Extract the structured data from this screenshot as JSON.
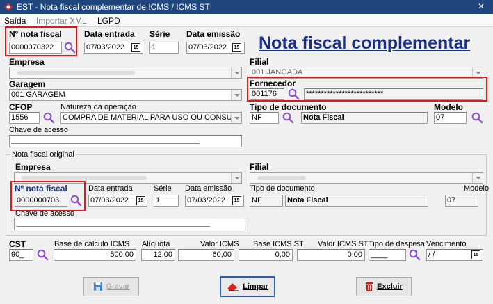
{
  "window": {
    "title": "EST - Nota fiscal complementar de ICMS / ICMS ST",
    "close": "×"
  },
  "menu": [
    "Saída",
    "Importar XML",
    "LGPD"
  ],
  "heading": "Nota fiscal complementar",
  "top": {
    "nf_label": "Nº nota fiscal",
    "nf_value": "0000070322",
    "data_entrada_label": "Data entrada",
    "data_entrada": "07/03/2022",
    "serie_label": "Série",
    "serie": "1",
    "data_emissao_label": "Data emissão",
    "data_emissao": "07/03/2022",
    "empresa_label": "Empresa",
    "filial_label": "Filial",
    "filial": "001 JANGADA",
    "garagem_label": "Garagem",
    "garagem": "001 GARAGEM",
    "fornecedor_label": "Fornecedor",
    "fornecedor_code": "001176",
    "fornecedor_name": "**************************",
    "cfop_label": "CFOP",
    "cfop": "1556",
    "natureza_label": "Natureza da operação",
    "natureza": "COMPRA DE MATERIAL PARA USO OU CONSUMO",
    "tipo_doc_label": "Tipo de documento",
    "tipo_doc_code": "NF",
    "tipo_doc_name": "Nota Fiscal",
    "modelo_label": "Modelo",
    "modelo": "07",
    "chave_label": "Chave de acesso"
  },
  "original": {
    "group_label": "Nota fiscal original",
    "empresa_label": "Empresa",
    "filial_label": "Filial",
    "nf_label": "Nº nota fiscal",
    "nf_value": "0000000703",
    "data_entrada_label": "Data entrada",
    "data_entrada": "07/03/2022",
    "serie_label": "Série",
    "serie": "1",
    "data_emissao_label": "Data emissão",
    "data_emissao": "07/03/2022",
    "tipo_doc_label": "Tipo de documento",
    "tipo_doc_code": "NF",
    "tipo_doc_name": "Nota Fiscal",
    "modelo_label": "Modelo",
    "modelo": "07",
    "chave_label": "Chave de acesso"
  },
  "bottom": {
    "cst_label": "CST",
    "cst": "90_",
    "base_icms_label": "Base de cálculo ICMS",
    "base_icms": "500,00",
    "aliquota_label": "Alíquota",
    "aliquota": "12,00",
    "valor_icms_label": "Valor ICMS",
    "valor_icms": "60,00",
    "base_st_label": "Base ICMS ST",
    "base_st": "0,00",
    "valor_st_label": "Valor ICMS ST",
    "valor_st": "0,00",
    "tipo_despesa_label": "Tipo de despesa",
    "tipo_despesa": "____",
    "vencimento_label": "Vencimento",
    "vencimento": "/ /"
  },
  "buttons": {
    "gravar": "Gravar",
    "limpar": "Limpar",
    "excluir": "Excluir"
  },
  "colors": {
    "title_bar": "#1f477d",
    "heading": "#1a2f8c",
    "highlight": "#e01818",
    "search_icon": "#8a4fd0"
  },
  "icons": {
    "search": "magnifier-icon",
    "calendar": "calendar-icon"
  }
}
